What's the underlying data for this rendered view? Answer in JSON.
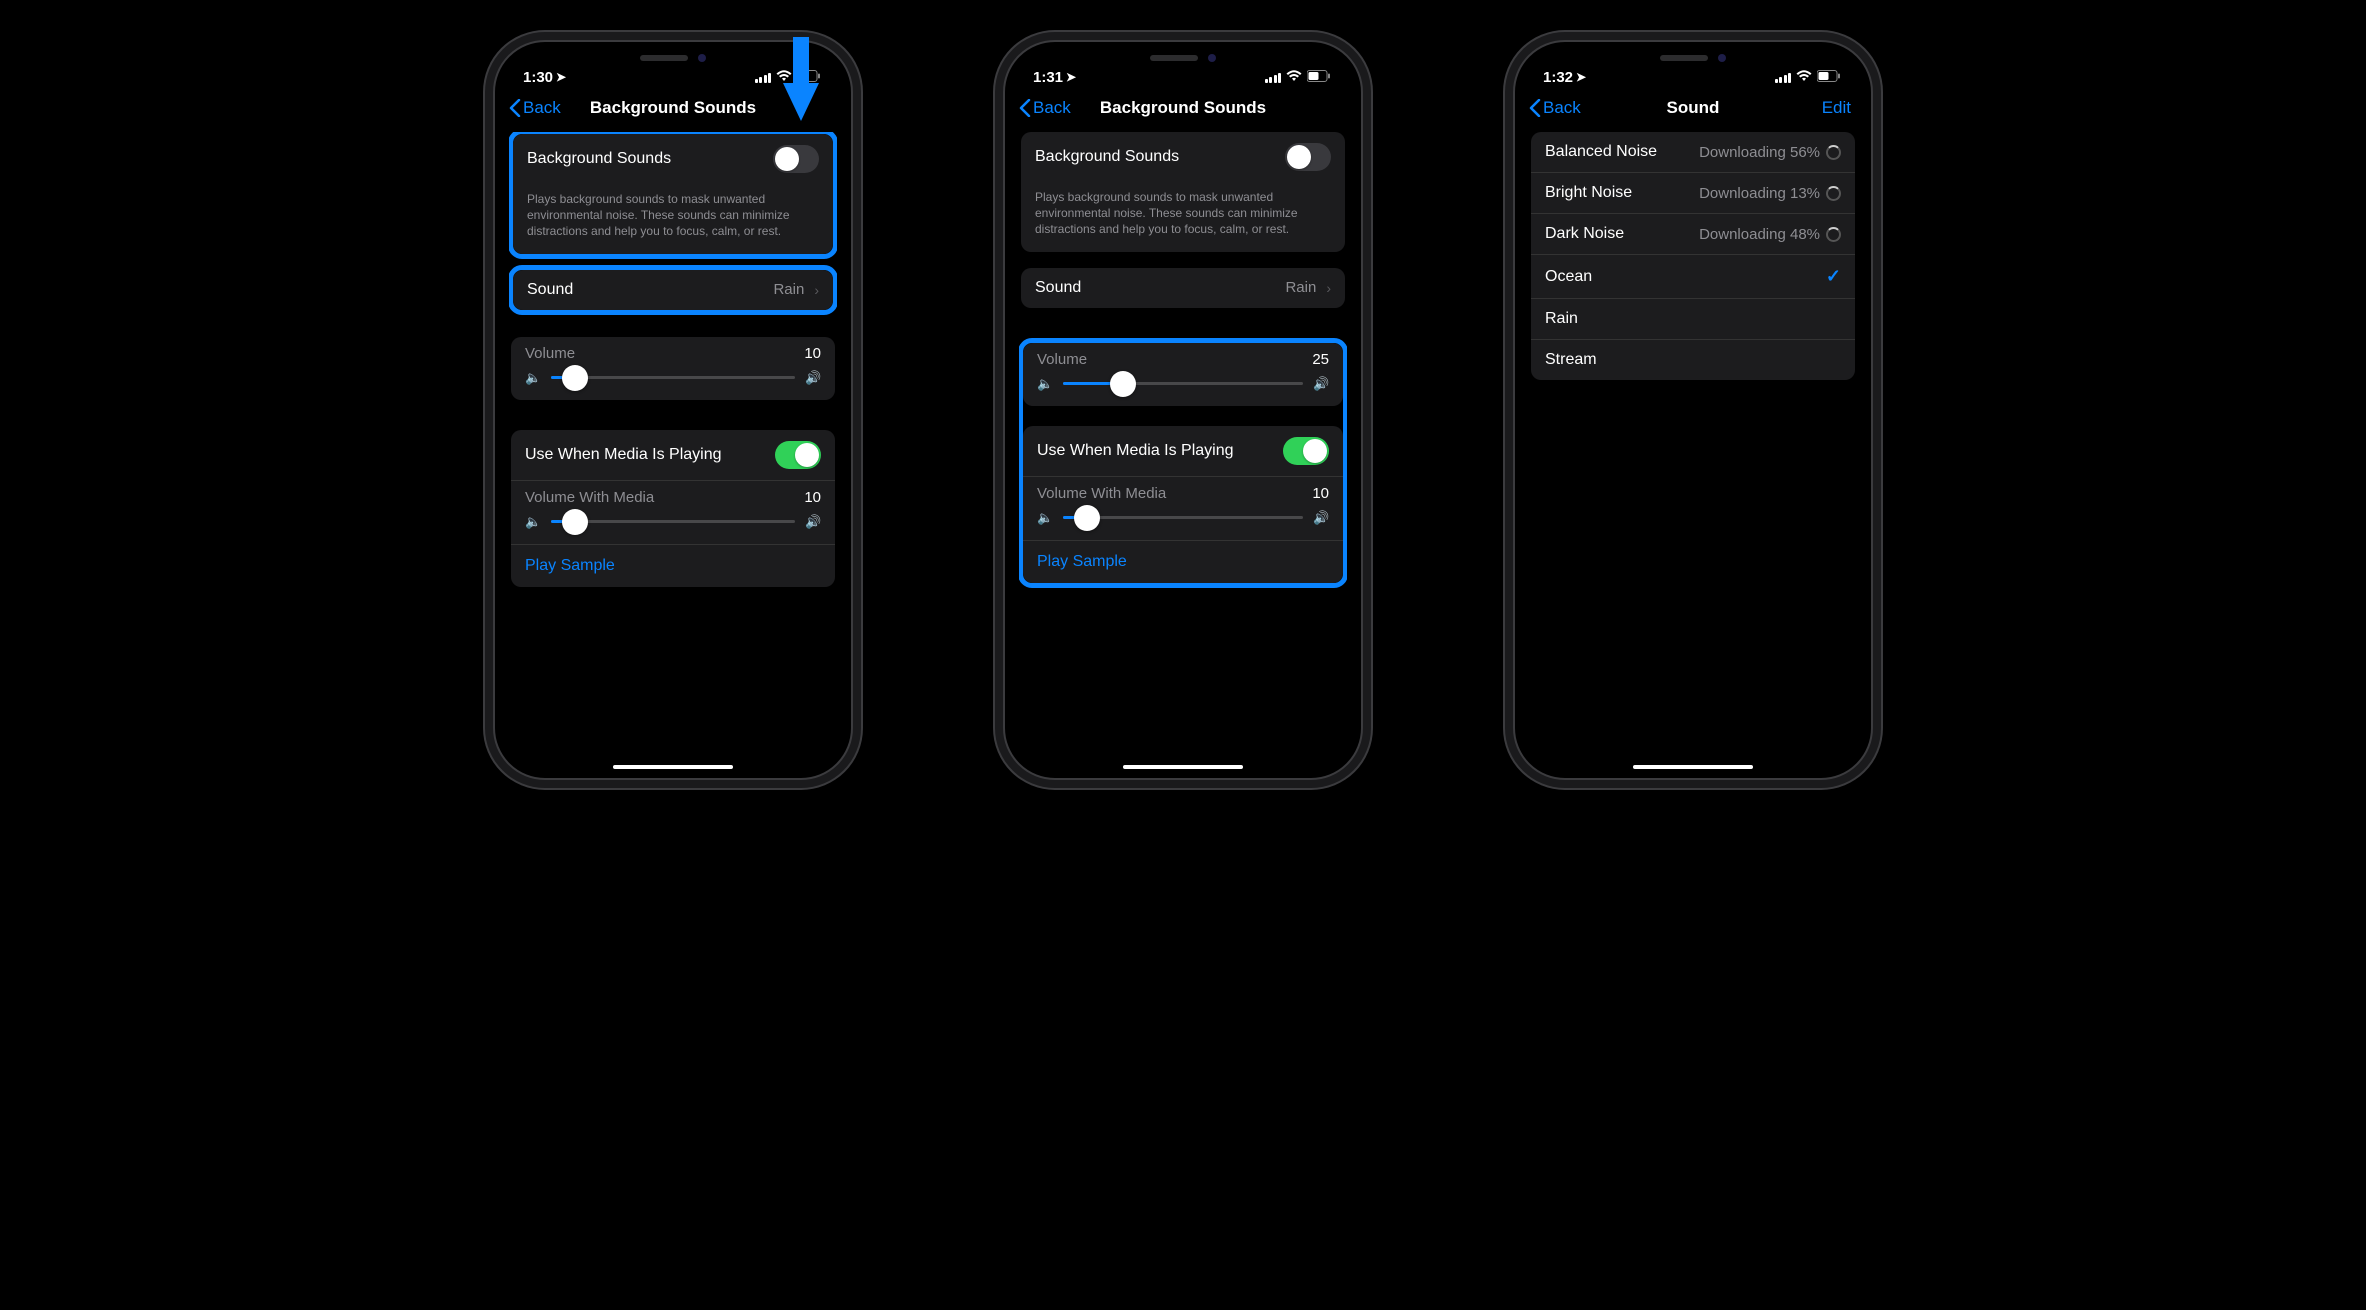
{
  "phone1": {
    "time": "1:30",
    "back": "Back",
    "title": "Background Sounds",
    "toggle_label": "Background Sounds",
    "toggle_on": false,
    "footer": "Plays background sounds to mask unwanted environmental noise. These sounds can minimize distractions and help you to focus, calm, or rest.",
    "sound_label": "Sound",
    "sound_value": "Rain",
    "volume_label": "Volume",
    "volume_value": "10",
    "volume_percent": 10,
    "media_toggle_label": "Use When Media Is Playing",
    "media_toggle_on": true,
    "media_volume_label": "Volume With Media",
    "media_volume_value": "10",
    "media_volume_percent": 10,
    "play_sample": "Play Sample"
  },
  "phone2": {
    "time": "1:31",
    "back": "Back",
    "title": "Background Sounds",
    "toggle_label": "Background Sounds",
    "toggle_on": false,
    "footer": "Plays background sounds to mask unwanted environmental noise. These sounds can minimize distractions and help you to focus, calm, or rest.",
    "sound_label": "Sound",
    "sound_value": "Rain",
    "volume_label": "Volume",
    "volume_value": "25",
    "volume_percent": 25,
    "media_toggle_label": "Use When Media Is Playing",
    "media_toggle_on": true,
    "media_volume_label": "Volume With Media",
    "media_volume_value": "10",
    "media_volume_percent": 10,
    "play_sample": "Play Sample"
  },
  "phone3": {
    "time": "1:32",
    "back": "Back",
    "title": "Sound",
    "edit": "Edit",
    "items": [
      {
        "name": "Balanced Noise",
        "status": "Downloading 56%",
        "downloading": true,
        "selected": false
      },
      {
        "name": "Bright Noise",
        "status": "Downloading 13%",
        "downloading": true,
        "selected": false
      },
      {
        "name": "Dark Noise",
        "status": "Downloading 48%",
        "downloading": true,
        "selected": false
      },
      {
        "name": "Ocean",
        "status": "",
        "downloading": false,
        "selected": true
      },
      {
        "name": "Rain",
        "status": "",
        "downloading": false,
        "selected": false
      },
      {
        "name": "Stream",
        "status": "",
        "downloading": false,
        "selected": false
      }
    ]
  }
}
